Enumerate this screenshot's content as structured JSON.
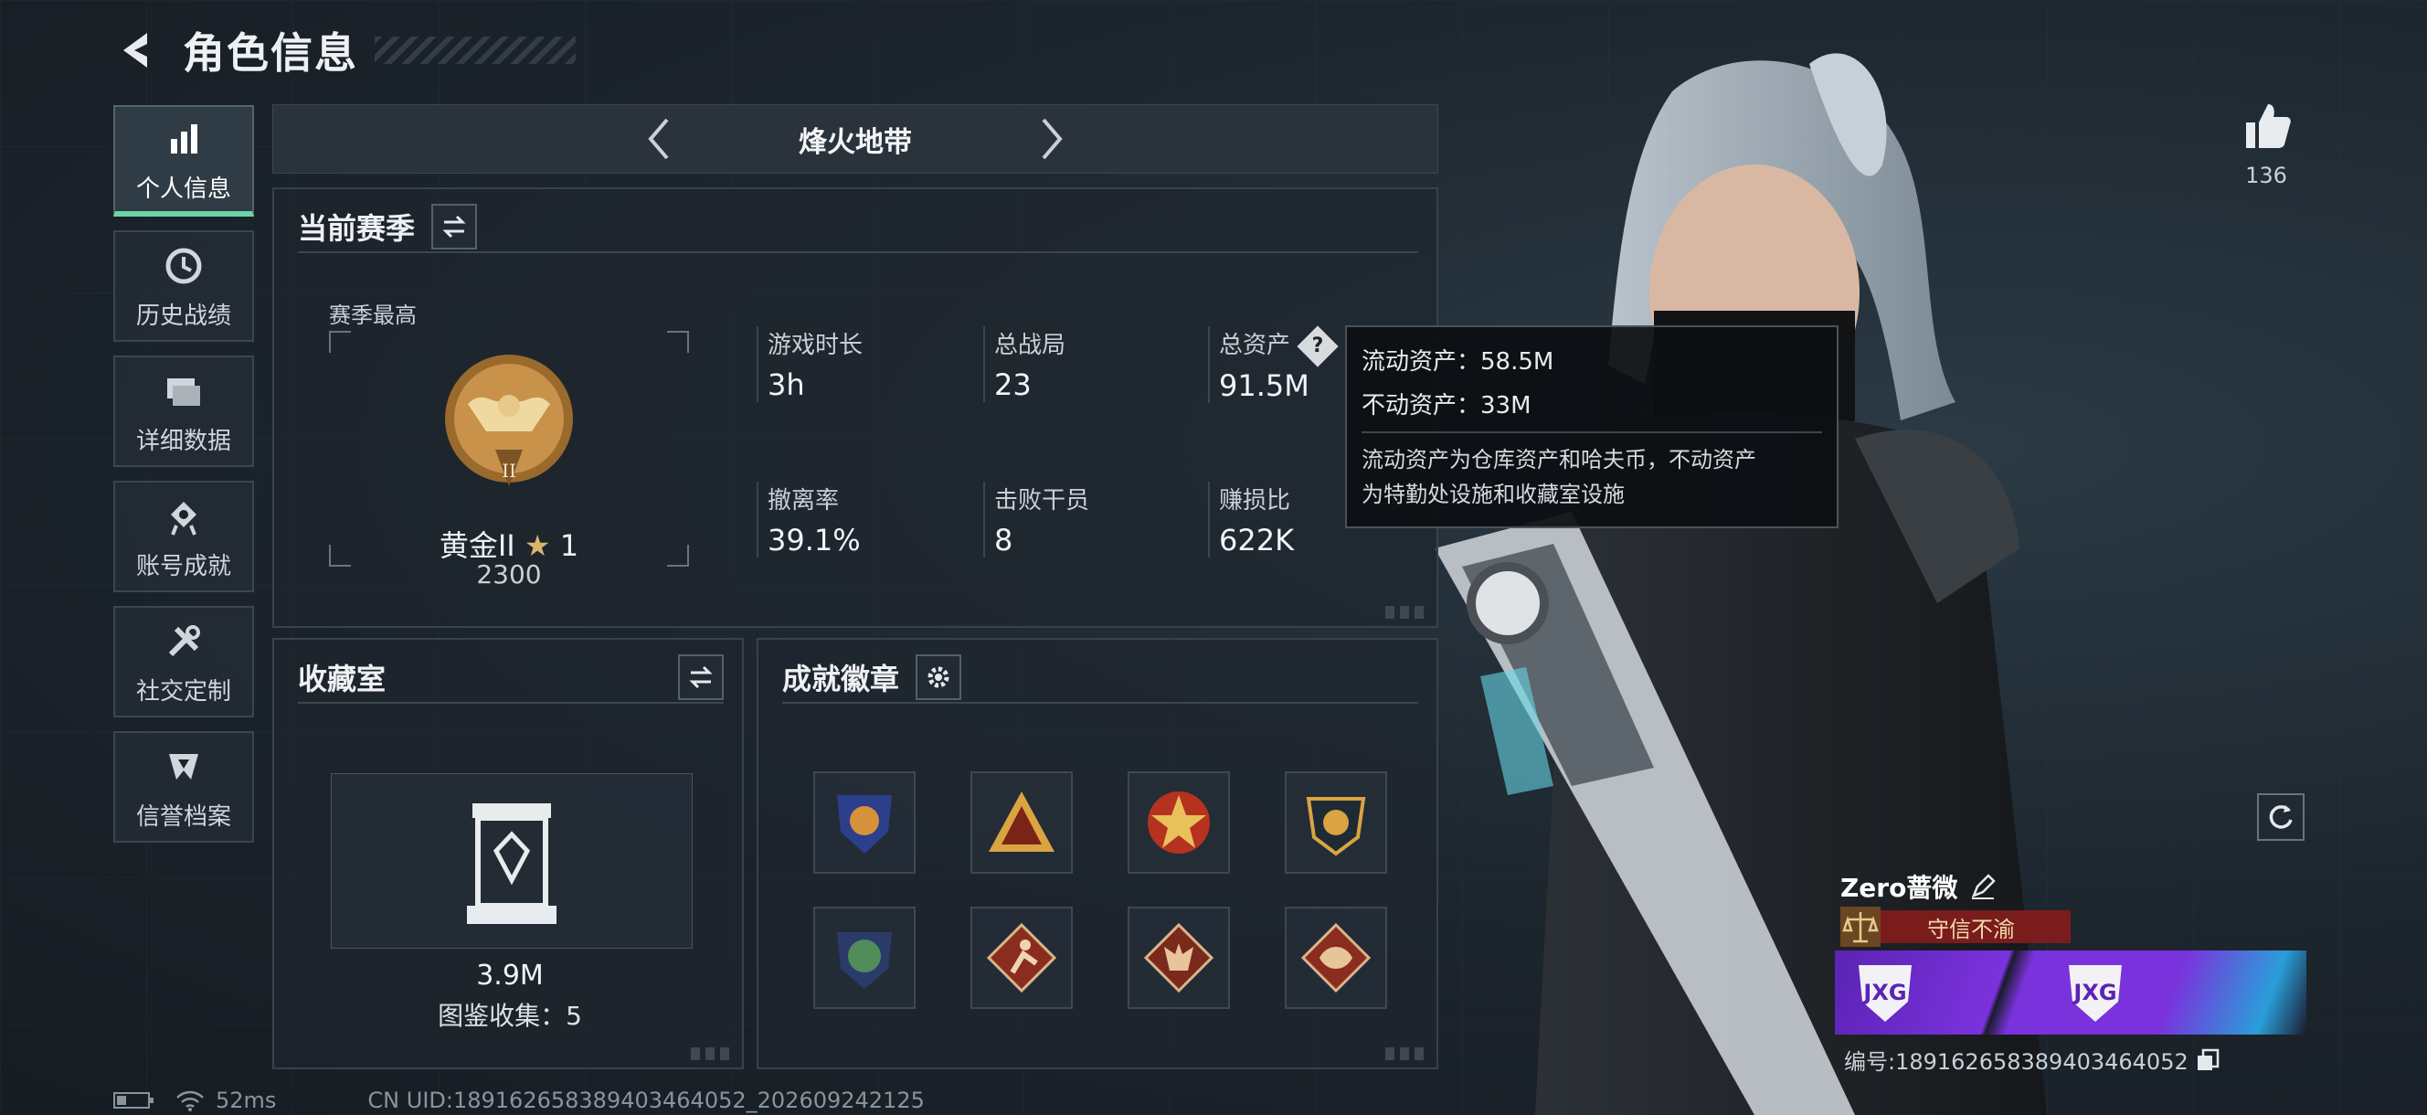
{
  "header": {
    "title": "角色信息"
  },
  "sidebar": {
    "items": [
      {
        "label": "个人信息",
        "icon": "bar-chart-icon",
        "active": true
      },
      {
        "label": "历史战绩",
        "icon": "history-icon"
      },
      {
        "label": "详细数据",
        "icon": "folder-icon"
      },
      {
        "label": "账号成就",
        "icon": "achievement-icon"
      },
      {
        "label": "社交定制",
        "icon": "tools-icon"
      },
      {
        "label": "信誉档案",
        "icon": "credit-icon"
      }
    ]
  },
  "mode_nav": {
    "title": "烽火地带"
  },
  "season": {
    "title": "当前赛季",
    "best_label": "赛季最高",
    "rank_name": "黄金II",
    "rank_stars": "1",
    "rank_score": "2300",
    "stats": [
      {
        "label": "游戏时长",
        "value": "3h"
      },
      {
        "label": "总战局",
        "value": "23"
      },
      {
        "label": "总资产",
        "value": "91.5M"
      },
      {
        "label": "撤离率",
        "value": "39.1%"
      },
      {
        "label": "击败干员",
        "value": "8"
      },
      {
        "label": "赚损比",
        "value": "622K"
      }
    ]
  },
  "tooltip": {
    "liquid": "流动资产：58.5M",
    "fixed": "不动资产：33M",
    "desc_line1": "流动资产为仓库资产和哈夫币，不动资产",
    "desc_line2": "为特勤处设施和收藏室设施"
  },
  "collection": {
    "title": "收藏室",
    "value": "3.9M",
    "count": "图鉴收集：5"
  },
  "badges": {
    "title": "成就徽章",
    "items": [
      "badge-shield-icon",
      "badge-triangle-icon",
      "badge-star-icon",
      "badge-emblem-icon",
      "badge-globe-icon",
      "badge-runner-icon",
      "badge-wolf-icon",
      "badge-dragon-icon"
    ]
  },
  "likes": {
    "count": "136"
  },
  "player": {
    "name": "Zero蔷微",
    "title": "守信不渝",
    "team_id": "编号:1891626583894034640​52"
  },
  "footer": {
    "ping": "52ms",
    "uid": "CN UID:1891626583894034640​52_202609242125"
  },
  "colors": {
    "accent": "#6fd3a8",
    "trust": "#7a1c1c",
    "team": "#7a32dc"
  }
}
